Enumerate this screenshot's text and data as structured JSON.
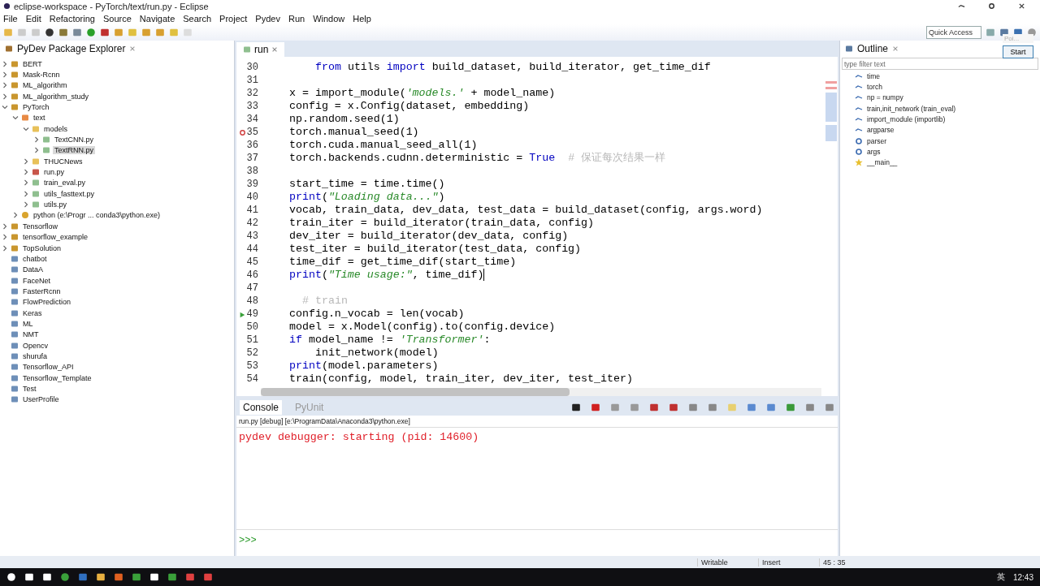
{
  "window": {
    "title": "eclipse-workspace - PyTorch/text/run.py - Eclipse"
  },
  "menu": [
    "File",
    "Edit",
    "Refactoring",
    "Source",
    "Navigate",
    "Search",
    "Project",
    "Pydev",
    "Run",
    "Window",
    "Help"
  ],
  "quick_access": {
    "placeholder": "Quick Access"
  },
  "explorer": {
    "title": "PyDev Package Explorer",
    "items": [
      {
        "label": "BERT",
        "kind": "project",
        "expanded": false
      },
      {
        "label": "Mask-Rcnn",
        "kind": "project",
        "expanded": false
      },
      {
        "label": "ML_algorithm",
        "kind": "project",
        "expanded": false
      },
      {
        "label": "ML_algorithm_study",
        "kind": "project",
        "expanded": false
      },
      {
        "label": "PyTorch",
        "kind": "project",
        "expanded": true,
        "children": [
          {
            "label": "text",
            "kind": "package",
            "expanded": true,
            "children": [
              {
                "label": "models",
                "kind": "folder",
                "expanded": true,
                "children": [
                  {
                    "label": "TextCNN.py",
                    "kind": "file",
                    "expanded": false,
                    "selected": false
                  },
                  {
                    "label": "TextRNN.py",
                    "kind": "file",
                    "expanded": false,
                    "selected": true
                  }
                ]
              },
              {
                "label": "THUCNews",
                "kind": "folder",
                "expanded": false
              },
              {
                "label": "run.py",
                "kind": "debugfile",
                "expanded": false
              },
              {
                "label": "train_eval.py",
                "kind": "file",
                "expanded": false
              },
              {
                "label": "utils_fasttext.py",
                "kind": "file",
                "expanded": false
              },
              {
                "label": "utils.py",
                "kind": "file",
                "expanded": false
              }
            ]
          },
          {
            "label": "python  (e:\\Progr ... conda3\\python.exe)",
            "kind": "interpreter",
            "expanded": false
          }
        ]
      },
      {
        "label": "Tensorflow",
        "kind": "project",
        "expanded": false
      },
      {
        "label": "tensorflow_example",
        "kind": "project",
        "expanded": false
      },
      {
        "label": "TopSolution",
        "kind": "project",
        "expanded": false
      },
      {
        "label": "chatbot",
        "kind": "closed"
      },
      {
        "label": "DataA",
        "kind": "closed"
      },
      {
        "label": "FaceNet",
        "kind": "closed"
      },
      {
        "label": "FasterRcnn",
        "kind": "closed"
      },
      {
        "label": "FlowPrediction",
        "kind": "closed"
      },
      {
        "label": "Keras",
        "kind": "closed"
      },
      {
        "label": "ML",
        "kind": "closed"
      },
      {
        "label": "NMT",
        "kind": "closed"
      },
      {
        "label": "Opencv",
        "kind": "closed"
      },
      {
        "label": "shurufa",
        "kind": "closed"
      },
      {
        "label": "Tensorflow_API",
        "kind": "closed"
      },
      {
        "label": "Tensorflow_Template",
        "kind": "closed"
      },
      {
        "label": "Test",
        "kind": "closed"
      },
      {
        "label": "UserProfile",
        "kind": "closed"
      }
    ]
  },
  "editor": {
    "tab": "run",
    "lines": [
      {
        "number": "30",
        "indented": true,
        "tokens": [
          {
            "t": "from",
            "kind": "kw"
          },
          {
            "t": " utils "
          },
          {
            "t": "import",
            "kind": "kw"
          },
          {
            "t": " build_dataset, build_iterator, get_time_dif"
          }
        ]
      },
      {
        "number": "31"
      },
      {
        "number": "32",
        "tokens": [
          {
            "t": "x = import_module("
          },
          {
            "t": "'models.'",
            "kind": "str"
          },
          {
            "t": " + model_name)"
          }
        ]
      },
      {
        "number": "33",
        "tokens": [
          {
            "t": "config = x.Config(dataset, embedding)"
          }
        ]
      },
      {
        "number": "34",
        "tokens": [
          {
            "t": "np.random.seed(1)"
          }
        ]
      },
      {
        "number": "35",
        "breakpoint": true,
        "tokens": [
          {
            "t": "torch.manual_seed(1)"
          }
        ]
      },
      {
        "number": "36",
        "tokens": [
          {
            "t": "torch.cuda.manual_seed_all(1)"
          }
        ]
      },
      {
        "number": "37",
        "tokens": [
          {
            "t": "torch.backends.cudnn.deterministic = "
          },
          {
            "t": "True",
            "kind": "kw"
          },
          {
            "t": "# 保证每次结果一样",
            "kind": "comment"
          }
        ]
      },
      {
        "number": "38"
      },
      {
        "number": "39",
        "tokens": [
          {
            "t": "start_time = time.time()"
          }
        ]
      },
      {
        "number": "40",
        "tokens": [
          {
            "t": "print",
            "kind": "kw"
          },
          {
            "t": "("
          },
          {
            "t": "\"Loading data...\"",
            "kind": "str"
          },
          {
            "t": ")"
          }
        ]
      },
      {
        "number": "41",
        "tokens": [
          {
            "t": "vocab, train_data, dev_data, test_data = build_dataset(config, args.word)"
          }
        ]
      },
      {
        "number": "42",
        "tokens": [
          {
            "t": "train_iter = build_iterator(train_data, config)"
          }
        ]
      },
      {
        "number": "43",
        "tokens": [
          {
            "t": "dev_iter = build_iterator(dev_data, config)"
          }
        ]
      },
      {
        "number": "44",
        "tokens": [
          {
            "t": "test_iter = build_iterator(test_data, config)"
          }
        ]
      },
      {
        "number": "45",
        "tokens": [
          {
            "t": "time_dif = get_time_dif(start_time)"
          }
        ]
      },
      {
        "number": "46",
        "current": true,
        "tokens": [
          {
            "t": "print",
            "kind": "kw"
          },
          {
            "t": "("
          },
          {
            "t": "\"Time usage:\"",
            "kind": "str"
          },
          {
            "t": ", time_dif)"
          }
        ]
      },
      {
        "number": "47"
      },
      {
        "number": "48",
        "tokens": [
          {
            "t": "# train",
            "kind": "comment"
          }
        ]
      },
      {
        "number": "49",
        "debug_position": true,
        "tokens": [
          {
            "t": "config.n_vocab = len(vocab)"
          }
        ]
      },
      {
        "number": "50",
        "tokens": [
          {
            "t": "model = x.Model(config).to(config.device)"
          }
        ]
      },
      {
        "number": "51",
        "tokens": [
          {
            "t": "if",
            "kind": "kw"
          },
          {
            "t": " model_name != "
          },
          {
            "t": "'Transformer'",
            "kind": "str"
          },
          {
            "t": ":"
          }
        ]
      },
      {
        "number": "52",
        "indented": true,
        "tokens": [
          {
            "t": "init_network(model)"
          }
        ]
      },
      {
        "number": "53",
        "tokens": [
          {
            "t": "print",
            "kind": "kw"
          },
          {
            "t": "(model.parameters)"
          }
        ]
      },
      {
        "number": "54",
        "tokens": [
          {
            "t": "train(config, model, train_iter, dev_iter, test_iter)"
          }
        ]
      }
    ]
  },
  "outline": {
    "title": "Outline",
    "filter": {
      "placeholder": "type filter text"
    },
    "items": [
      {
        "label": "time",
        "kind": "import"
      },
      {
        "label": "torch",
        "kind": "import"
      },
      {
        "label": "np = numpy",
        "kind": "import"
      },
      {
        "label": "train,init_network (train_eval)",
        "kind": "import"
      },
      {
        "label": "import_module (importlib)",
        "kind": "import"
      },
      {
        "label": "argparse",
        "kind": "import"
      },
      {
        "label": "parser",
        "kind": "variable"
      },
      {
        "label": "args",
        "kind": "variable"
      },
      {
        "label": "__main__",
        "kind": "main"
      }
    ]
  },
  "popup": {
    "text": "Poi...",
    "button": "Start"
  },
  "console": {
    "tabs": [
      {
        "label": "Console",
        "selected": true
      },
      {
        "label": "PyUnit",
        "selected": false
      }
    ],
    "process": "run.py [debug] [e:\\ProgramData\\Anaconda3\\python.exe]",
    "output": "pydev debugger: starting (pid: 14600)",
    "prompt": ">>>"
  },
  "status_bar": [
    "Writable",
    "Insert",
    "45 : 35"
  ],
  "taskbar": {
    "language": "英",
    "clock": "12:43"
  }
}
